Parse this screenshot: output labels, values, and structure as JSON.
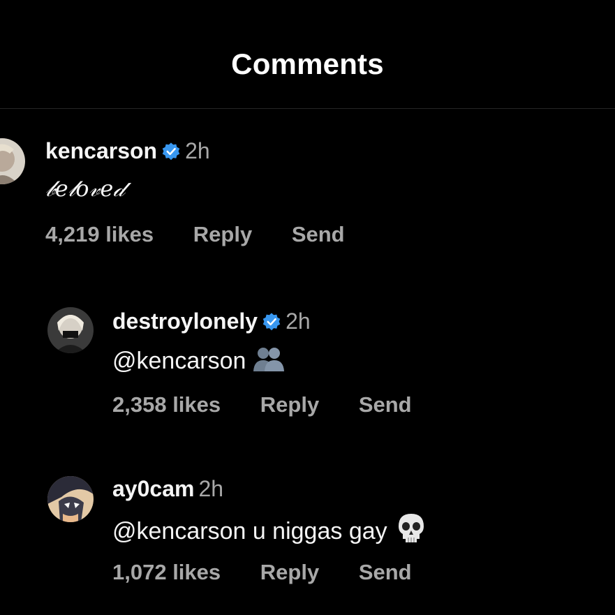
{
  "header": {
    "title": "Comments"
  },
  "comments": [
    {
      "username": "kencarson",
      "verified": true,
      "time": "2h",
      "text": "𝒷𝑒𝓁𝑜𝓋𝑒𝒹",
      "likes": "4,219 likes",
      "reply": "Reply",
      "send": "Send"
    },
    {
      "username": "destroylonely",
      "verified": true,
      "time": "2h",
      "text": "@kencarson",
      "emoji": "busts-in-silhouette-icon",
      "likes": "2,358 likes",
      "reply": "Reply",
      "send": "Send"
    },
    {
      "username": "ay0cam",
      "verified": false,
      "time": "2h",
      "text": "@kencarson u niggas gay",
      "emoji": "skull-icon",
      "likes": "1,072 likes",
      "reply": "Reply",
      "send": "Send"
    }
  ],
  "colors": {
    "background": "#000000",
    "primary_text": "#f5f5f5",
    "secondary_text": "#a8a8a8",
    "verified_blue": "#3897f0",
    "divider": "#262626"
  }
}
